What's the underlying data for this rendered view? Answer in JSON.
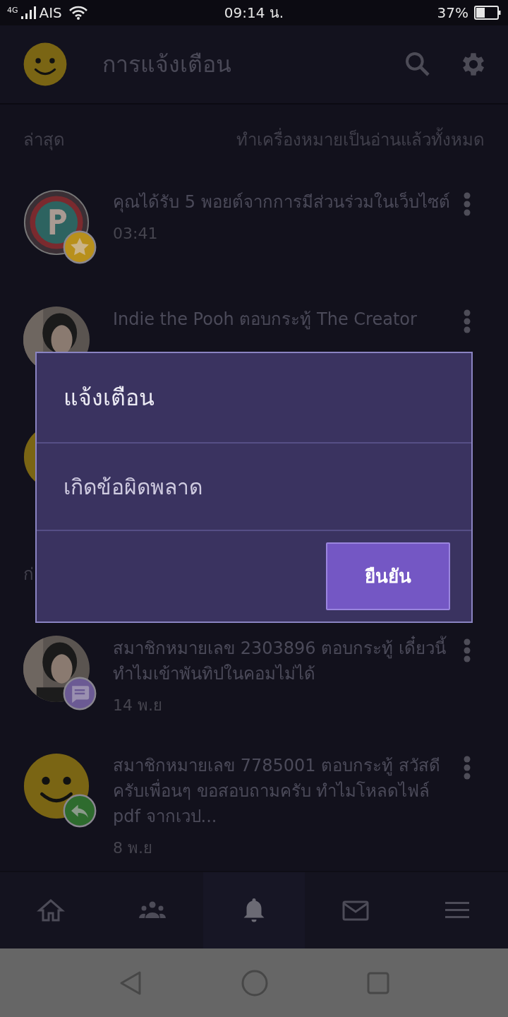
{
  "status_bar": {
    "network": "4G",
    "carrier": "AIS",
    "time": "09:14 น.",
    "battery": "37%"
  },
  "header": {
    "title": "การแจ้งเตือน"
  },
  "latest": {
    "label": "ล่าสุด",
    "action": "ทำเครื่องหมายเป็นอ่านแล้วทั้งหมด"
  },
  "notifications": [
    {
      "kind": "points",
      "badge": {
        "kind": "star",
        "color": "#b8901c"
      },
      "text": "คุณได้รับ 5 พอยต์จากการมีส่วนร่วมในเว็บไซต์",
      "time": "03:41"
    },
    {
      "kind": "picture",
      "text": "Indie the Pooh ตอบกระทู้ The Creator"
    },
    {
      "kind": "smiley"
    }
  ],
  "earlier": {
    "label": "ก่"
  },
  "earlier_notifications": [
    {
      "kind": "picture",
      "badge": {
        "kind": "comment",
        "color": "#6b5a94"
      },
      "text": "สมาชิกหมายเลข 2303896 ตอบกระทู้ เดี๋ยวนี้ทำไมเข้าพันทิปในคอมไม่ได้",
      "time": "14 พ.ย"
    },
    {
      "kind": "smiley",
      "badge": {
        "kind": "reply",
        "color": "#2e6b2e"
      },
      "text": "สมาชิกหมายเลข 7785001 ตอบกระทู้ สวัสดีครับเพื่อนๆ ขอสอบถามครับ ทำไมโหลดไฟล์ pdf จากเวป...",
      "time": "8 พ.ย"
    }
  ],
  "dialog": {
    "title": "แจ้งเตือน",
    "message": "เกิดข้อผิดพลาด",
    "button": "ยืนยัน"
  },
  "nav": [
    {
      "selected": false
    },
    {
      "selected": false
    },
    {
      "selected": true
    },
    {
      "selected": false
    },
    {
      "selected": false
    }
  ]
}
